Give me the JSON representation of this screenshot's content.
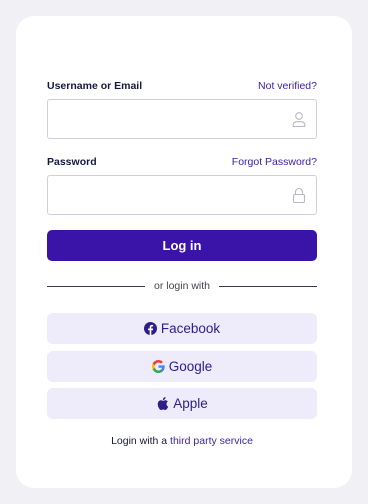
{
  "username": {
    "label": "Username or Email",
    "link": "Not verified?",
    "value": "",
    "icon": "user-icon"
  },
  "password": {
    "label": "Password",
    "link": "Forgot Password?",
    "value": "",
    "icon": "lock-icon"
  },
  "login_button": "Log in",
  "divider_text": "or login with",
  "social": {
    "facebook": {
      "label": "Facebook",
      "icon": "facebook-icon"
    },
    "google": {
      "label": "Google",
      "icon": "google-icon"
    },
    "apple": {
      "label": "Apple",
      "icon": "apple-icon"
    }
  },
  "footer": {
    "prefix": "Login with a",
    "link": "third party service"
  },
  "colors": {
    "primary": "#3a13a8",
    "link": "#3a1fa8",
    "social_bg": "#eeebfa",
    "text": "#17183a"
  }
}
